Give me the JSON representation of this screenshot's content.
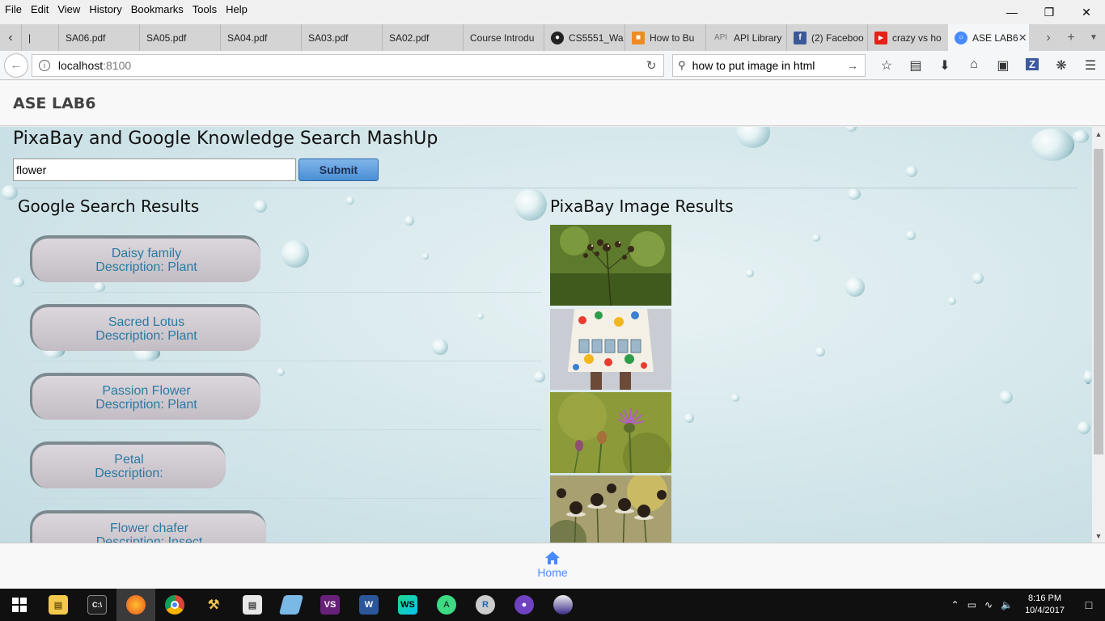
{
  "browser": {
    "menu": [
      "File",
      "Edit",
      "View",
      "History",
      "Bookmarks",
      "Tools",
      "Help"
    ],
    "menu_access_keys": [
      "F",
      "E",
      "V",
      "s",
      "B",
      "T",
      "H"
    ],
    "tabs": [
      {
        "label": "SA06.pdf",
        "icon": "none"
      },
      {
        "label": "SA05.pdf",
        "icon": "none"
      },
      {
        "label": "SA04.pdf",
        "icon": "none"
      },
      {
        "label": "SA03.pdf",
        "icon": "none"
      },
      {
        "label": "SA02.pdf",
        "icon": "none"
      },
      {
        "label": "Course Introdu",
        "icon": "none"
      },
      {
        "label": "CS5551_Wa",
        "icon": "github-icon"
      },
      {
        "label": "How to Bu",
        "icon": "cube-icon"
      },
      {
        "label": "API Library",
        "icon": "api-icon"
      },
      {
        "label": "(2) Faceboo",
        "icon": "facebook-icon"
      },
      {
        "label": "crazy vs ho",
        "icon": "youtube-icon"
      }
    ],
    "active_tab": {
      "label": "ASE LAB6",
      "icon": "ionic-icon"
    },
    "url_host": "localhost",
    "url_port": ":8100",
    "search_query": "how to put image in html"
  },
  "app": {
    "header_title": "ASE LAB6",
    "page_title": "PixaBay and Google Knowledge Search MashUp",
    "search_value": "flower",
    "submit_label": "Submit",
    "google_title": "Google Search Results",
    "pixabay_title": "PixaBay Image Results",
    "results": [
      {
        "name": "Daisy family",
        "description": "Description: Plant"
      },
      {
        "name": "Sacred Lotus",
        "description": "Description: Plant"
      },
      {
        "name": "Passion Flower",
        "description": "Description: Plant"
      },
      {
        "name": "Petal",
        "description": "Description:"
      },
      {
        "name": "Flower chafer",
        "description": "Description: Insect"
      }
    ],
    "images": [
      "wildflower-seed-heads",
      "happy-dress",
      "purple-thistle",
      "dark-coneflowers"
    ],
    "bottom_tab_label": "Home"
  },
  "taskbar": {
    "time": "8:16 PM",
    "date": "10/4/2017"
  },
  "colors": {
    "accent": "#488aff",
    "result_text": "#2a7aa2",
    "submit": "#4a8fd6"
  }
}
